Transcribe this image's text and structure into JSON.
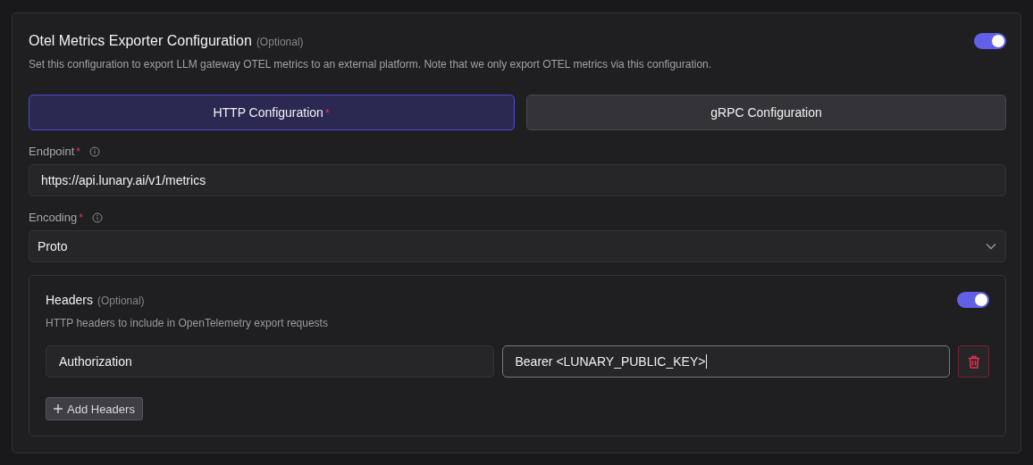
{
  "card": {
    "title": "Otel Metrics Exporter Configuration",
    "optional_tag": "(Optional)",
    "enabled": true,
    "description": "Set this configuration to export LLM gateway OTEL metrics to an external platform. Note that we only export OTEL metrics via this configuration."
  },
  "tabs": [
    {
      "label": "HTTP Configuration",
      "required_mark": "*",
      "selected": true
    },
    {
      "label": "gRPC Configuration",
      "selected": false
    }
  ],
  "fields": [
    {
      "kind": "text",
      "label": "Endpoint",
      "required_mark": "*",
      "value": "https://api.lunary.ai/v1/metrics"
    },
    {
      "kind": "select",
      "label": "Encoding",
      "required_mark": "*",
      "value": "Proto"
    }
  ],
  "headers": {
    "title": "Headers",
    "optional_tag": "(Optional)",
    "enabled": true,
    "description": "HTTP headers to include in OpenTelemetry export requests",
    "rows": [
      {
        "key": "Authorization",
        "value": "Bearer <LUNARY_PUBLIC_KEY>",
        "value_focused": true
      }
    ],
    "add_button": "Add Headers"
  }
}
